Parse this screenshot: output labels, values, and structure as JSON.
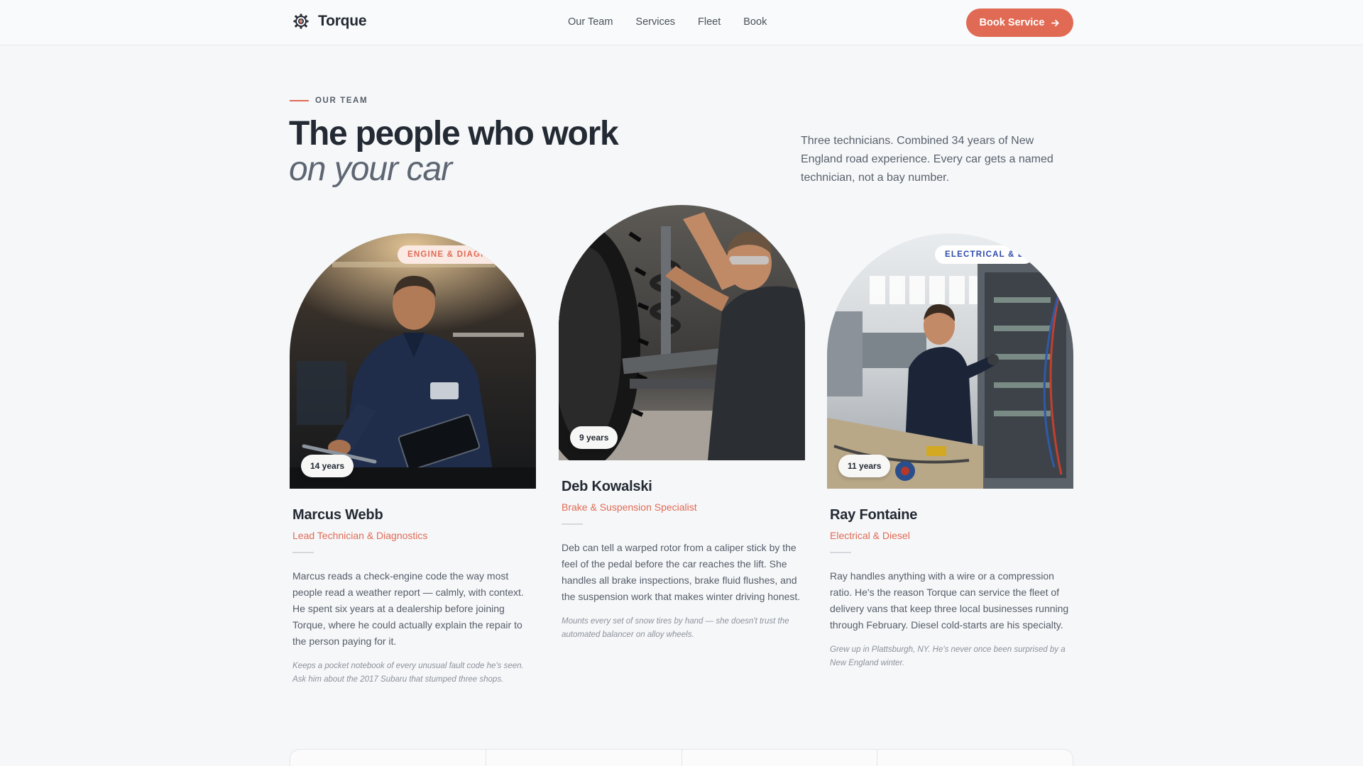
{
  "header": {
    "brand": "Torque",
    "nav": [
      "Our Team",
      "Services",
      "Fleet",
      "Book"
    ],
    "cta_label": "Book Service"
  },
  "hero": {
    "eyebrow": "OUR TEAM",
    "title_line1": "The people who work",
    "title_line2": "on your car",
    "intro": "Three technicians. Combined 34 years of New England road experience. Every car gets a named technician, not a bay number."
  },
  "team": [
    {
      "name": "Marcus Webb",
      "role": "Lead Technician & Diagnostics",
      "tag": "ENGINE & DIAGNO",
      "years": "14 years",
      "bio": "Marcus reads a check-engine code the way most people read a weather report — calmly, with context. He spent six years at a dealership before joining Torque, where he could actually explain the repair to the person paying for it.",
      "note": "Keeps a pocket notebook of every unusual fault code he's seen. Ask him about the 2017 Subaru that stumped three shops."
    },
    {
      "name": "Deb Kowalski",
      "role": "Brake & Suspension Specialist",
      "tag": "",
      "years": "9 years",
      "bio": "Deb can tell a warped rotor from a caliper stick by the feel of the pedal before the car reaches the lift. She handles all brake inspections, brake fluid flushes, and the suspension work that makes winter driving honest.",
      "note": "Mounts every set of snow tires by hand — she doesn't trust the automated balancer on alloy wheels."
    },
    {
      "name": "Ray Fontaine",
      "role": "Electrical & Diesel",
      "tag": "ELECTRICAL & D",
      "years": "11 years",
      "bio": "Ray handles anything with a wire or a compression ratio. He's the reason Torque can service the fleet of delivery vans that keep three local businesses running through February. Diesel cold-starts are his specialty.",
      "note": "Grew up in Plattsburgh, NY. He's never once been surprised by a New England winter."
    }
  ],
  "colors": {
    "accent": "#e06a54",
    "text": "#232a33",
    "muted": "#59616c",
    "background": "#f6f7f9",
    "tag_blue": "#2d4aa8"
  },
  "icons": {
    "brand": "gear-wrench-icon",
    "cta": "arrow-right-icon"
  }
}
